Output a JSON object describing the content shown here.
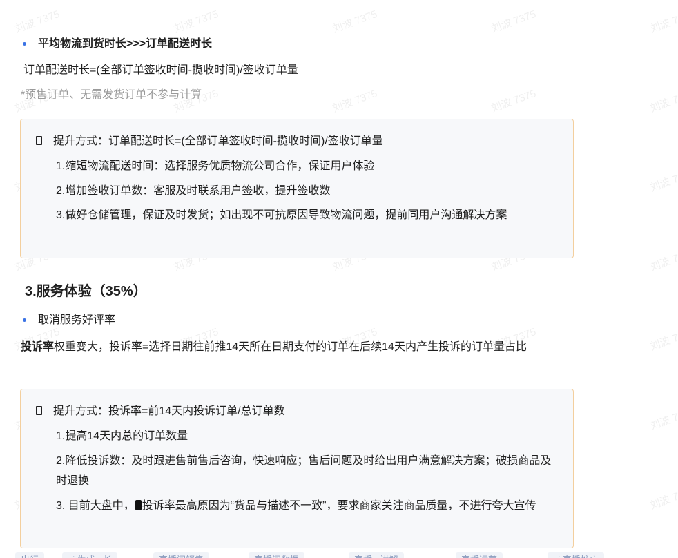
{
  "watermark_text": "刘波 7375",
  "section1": {
    "bullet_title": "平均物流到货时长>>>订单配送时长",
    "formula": "订单配送时长=(全部订单签收时间-揽收时间)/签收订单量",
    "note": "*预售订单、无需发货订单不参与计算",
    "card": {
      "head": "提升方式：订单配送时长=(全部订单签收时间-揽收时间)/签收订单量",
      "items": [
        "1.缩短物流配送时间：选择服务优质物流公司合作，保证用户体验",
        "2.增加签收订单数：客服及时联系用户签收，提升签收数",
        "3.做好仓储管理，保证及时发货；如出现不可抗原因导致物流问题，提前同用户沟通解决方案"
      ]
    }
  },
  "section3": {
    "title": "3.服务体验（35%）",
    "bullet": "取消服务好评率",
    "para_bold": "投诉率",
    "para_rest": "权重变大，投诉率=选择日期往前推14天所在日期支付的订单在后续14天内产生投诉的订单量占比",
    "card": {
      "head": "提升方式：投诉率=前14天内投诉订单/总订单数",
      "items": [
        "1.提高14天内总的订单数量",
        "2.降低投诉数：及时跟进售前售后咨询，快速响应；售后问题及时给出用户满意解决方案；破损商品及时退换",
        "3. 目前大盘中，",
        "投诉率最高原因为“货品与描述不一致”，要求商家关注商品质量，不进行夸大宣传"
      ]
    }
  },
  "bottom_tabs": [
    "出行",
    "ai 生成 · 长",
    "直播间销售",
    "直播间数据",
    "直播 · 讲解",
    "直播运营",
    "ai 直播推广"
  ]
}
